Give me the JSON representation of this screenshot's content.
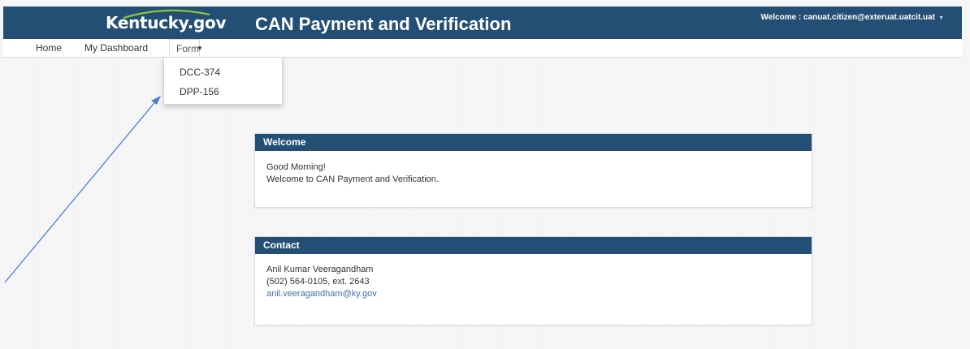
{
  "header": {
    "logo_text": "Kentucky.gov",
    "app_title": "CAN Payment and Verification",
    "welcome_user": "Welcome : canuat.citizen@exteruat.uatcit.uat"
  },
  "nav": {
    "home": "Home",
    "dashboard": "My Dashboard",
    "form": "Form"
  },
  "dropdown": {
    "items": [
      "DCC-374",
      "DPP-156"
    ]
  },
  "welcome_panel": {
    "title": "Welcome",
    "greeting": "Good Morning!",
    "message": "Welcome to CAN Payment and Verification."
  },
  "contact_panel": {
    "title": "Contact",
    "name": "Anil Kumar Veeragandham",
    "phone": "(502) 564-0105, ext. 2643",
    "email": "anil.veeragandham@ky.gov"
  },
  "colors": {
    "header_bg": "#244f75",
    "link": "#3a6fb0",
    "annotation_arrow": "#4a7fd0"
  }
}
